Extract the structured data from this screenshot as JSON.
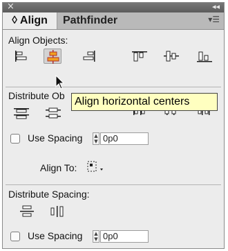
{
  "header": {
    "close_glyph": "×",
    "collapse_glyph": "◂◂"
  },
  "tabs": {
    "active": "◊ Align",
    "inactive": "Pathfinder",
    "menu_glyph": "▾☰"
  },
  "align_objects": {
    "label": "Align Objects:",
    "icons": [
      "align-left-edges-icon",
      "align-horizontal-centers-icon",
      "align-right-edges-icon",
      "align-top-edges-icon",
      "align-vertical-centers-icon",
      "align-bottom-edges-icon"
    ]
  },
  "tooltip": {
    "text": "Align horizontal centers"
  },
  "distribute_objects": {
    "label": "Distribute Ob",
    "use_spacing_label": "Use Spacing",
    "spacing_value": "0p0"
  },
  "align_to": {
    "label": "Align To:"
  },
  "distribute_spacing": {
    "label": "Distribute Spacing:",
    "use_spacing_label": "Use Spacing",
    "spacing_value": "0p0"
  }
}
